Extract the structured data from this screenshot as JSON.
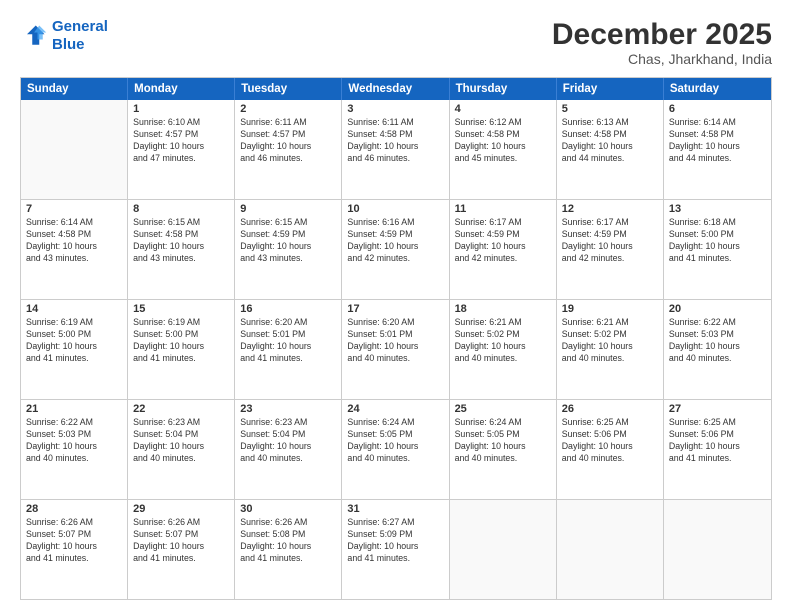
{
  "logo": {
    "line1": "General",
    "line2": "Blue"
  },
  "header": {
    "month": "December 2025",
    "location": "Chas, Jharkhand, India"
  },
  "weekdays": [
    "Sunday",
    "Monday",
    "Tuesday",
    "Wednesday",
    "Thursday",
    "Friday",
    "Saturday"
  ],
  "rows": [
    [
      {
        "day": "",
        "lines": []
      },
      {
        "day": "1",
        "lines": [
          "Sunrise: 6:10 AM",
          "Sunset: 4:57 PM",
          "Daylight: 10 hours",
          "and 47 minutes."
        ]
      },
      {
        "day": "2",
        "lines": [
          "Sunrise: 6:11 AM",
          "Sunset: 4:57 PM",
          "Daylight: 10 hours",
          "and 46 minutes."
        ]
      },
      {
        "day": "3",
        "lines": [
          "Sunrise: 6:11 AM",
          "Sunset: 4:58 PM",
          "Daylight: 10 hours",
          "and 46 minutes."
        ]
      },
      {
        "day": "4",
        "lines": [
          "Sunrise: 6:12 AM",
          "Sunset: 4:58 PM",
          "Daylight: 10 hours",
          "and 45 minutes."
        ]
      },
      {
        "day": "5",
        "lines": [
          "Sunrise: 6:13 AM",
          "Sunset: 4:58 PM",
          "Daylight: 10 hours",
          "and 44 minutes."
        ]
      },
      {
        "day": "6",
        "lines": [
          "Sunrise: 6:14 AM",
          "Sunset: 4:58 PM",
          "Daylight: 10 hours",
          "and 44 minutes."
        ]
      }
    ],
    [
      {
        "day": "7",
        "lines": [
          "Sunrise: 6:14 AM",
          "Sunset: 4:58 PM",
          "Daylight: 10 hours",
          "and 43 minutes."
        ]
      },
      {
        "day": "8",
        "lines": [
          "Sunrise: 6:15 AM",
          "Sunset: 4:58 PM",
          "Daylight: 10 hours",
          "and 43 minutes."
        ]
      },
      {
        "day": "9",
        "lines": [
          "Sunrise: 6:15 AM",
          "Sunset: 4:59 PM",
          "Daylight: 10 hours",
          "and 43 minutes."
        ]
      },
      {
        "day": "10",
        "lines": [
          "Sunrise: 6:16 AM",
          "Sunset: 4:59 PM",
          "Daylight: 10 hours",
          "and 42 minutes."
        ]
      },
      {
        "day": "11",
        "lines": [
          "Sunrise: 6:17 AM",
          "Sunset: 4:59 PM",
          "Daylight: 10 hours",
          "and 42 minutes."
        ]
      },
      {
        "day": "12",
        "lines": [
          "Sunrise: 6:17 AM",
          "Sunset: 4:59 PM",
          "Daylight: 10 hours",
          "and 42 minutes."
        ]
      },
      {
        "day": "13",
        "lines": [
          "Sunrise: 6:18 AM",
          "Sunset: 5:00 PM",
          "Daylight: 10 hours",
          "and 41 minutes."
        ]
      }
    ],
    [
      {
        "day": "14",
        "lines": [
          "Sunrise: 6:19 AM",
          "Sunset: 5:00 PM",
          "Daylight: 10 hours",
          "and 41 minutes."
        ]
      },
      {
        "day": "15",
        "lines": [
          "Sunrise: 6:19 AM",
          "Sunset: 5:00 PM",
          "Daylight: 10 hours",
          "and 41 minutes."
        ]
      },
      {
        "day": "16",
        "lines": [
          "Sunrise: 6:20 AM",
          "Sunset: 5:01 PM",
          "Daylight: 10 hours",
          "and 41 minutes."
        ]
      },
      {
        "day": "17",
        "lines": [
          "Sunrise: 6:20 AM",
          "Sunset: 5:01 PM",
          "Daylight: 10 hours",
          "and 40 minutes."
        ]
      },
      {
        "day": "18",
        "lines": [
          "Sunrise: 6:21 AM",
          "Sunset: 5:02 PM",
          "Daylight: 10 hours",
          "and 40 minutes."
        ]
      },
      {
        "day": "19",
        "lines": [
          "Sunrise: 6:21 AM",
          "Sunset: 5:02 PM",
          "Daylight: 10 hours",
          "and 40 minutes."
        ]
      },
      {
        "day": "20",
        "lines": [
          "Sunrise: 6:22 AM",
          "Sunset: 5:03 PM",
          "Daylight: 10 hours",
          "and 40 minutes."
        ]
      }
    ],
    [
      {
        "day": "21",
        "lines": [
          "Sunrise: 6:22 AM",
          "Sunset: 5:03 PM",
          "Daylight: 10 hours",
          "and 40 minutes."
        ]
      },
      {
        "day": "22",
        "lines": [
          "Sunrise: 6:23 AM",
          "Sunset: 5:04 PM",
          "Daylight: 10 hours",
          "and 40 minutes."
        ]
      },
      {
        "day": "23",
        "lines": [
          "Sunrise: 6:23 AM",
          "Sunset: 5:04 PM",
          "Daylight: 10 hours",
          "and 40 minutes."
        ]
      },
      {
        "day": "24",
        "lines": [
          "Sunrise: 6:24 AM",
          "Sunset: 5:05 PM",
          "Daylight: 10 hours",
          "and 40 minutes."
        ]
      },
      {
        "day": "25",
        "lines": [
          "Sunrise: 6:24 AM",
          "Sunset: 5:05 PM",
          "Daylight: 10 hours",
          "and 40 minutes."
        ]
      },
      {
        "day": "26",
        "lines": [
          "Sunrise: 6:25 AM",
          "Sunset: 5:06 PM",
          "Daylight: 10 hours",
          "and 40 minutes."
        ]
      },
      {
        "day": "27",
        "lines": [
          "Sunrise: 6:25 AM",
          "Sunset: 5:06 PM",
          "Daylight: 10 hours",
          "and 41 minutes."
        ]
      }
    ],
    [
      {
        "day": "28",
        "lines": [
          "Sunrise: 6:26 AM",
          "Sunset: 5:07 PM",
          "Daylight: 10 hours",
          "and 41 minutes."
        ]
      },
      {
        "day": "29",
        "lines": [
          "Sunrise: 6:26 AM",
          "Sunset: 5:07 PM",
          "Daylight: 10 hours",
          "and 41 minutes."
        ]
      },
      {
        "day": "30",
        "lines": [
          "Sunrise: 6:26 AM",
          "Sunset: 5:08 PM",
          "Daylight: 10 hours",
          "and 41 minutes."
        ]
      },
      {
        "day": "31",
        "lines": [
          "Sunrise: 6:27 AM",
          "Sunset: 5:09 PM",
          "Daylight: 10 hours",
          "and 41 minutes."
        ]
      },
      {
        "day": "",
        "lines": []
      },
      {
        "day": "",
        "lines": []
      },
      {
        "day": "",
        "lines": []
      }
    ]
  ]
}
